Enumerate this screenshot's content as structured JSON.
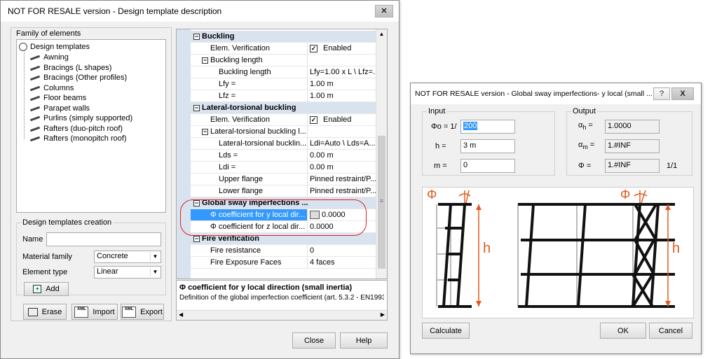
{
  "dialog_main": {
    "title": "NOT FOR RESALE version - Design template description",
    "family_label": "Family of elements",
    "tree": {
      "root": "Design templates",
      "items": [
        "Awning",
        "Bracings (L shapes)",
        "Bracings (Other profiles)",
        "Columns",
        "Floor beams",
        "Parapet walls",
        "Purlins (simply supported)",
        "Rafters (duo-pitch roof)",
        "Rafters (monopitch roof)"
      ]
    },
    "creation": {
      "label": "Design templates creation",
      "name_label": "Name",
      "name_value": "",
      "material_label": "Material family",
      "material_value": "Concrete",
      "element_type_label": "Element type",
      "element_type_value": "Linear",
      "add_label": "Add"
    },
    "buttons": {
      "erase": "Erase",
      "import": "Import",
      "export": "Export",
      "close": "Close",
      "help": "Help"
    },
    "properties": [
      {
        "name": "Buckling",
        "value": "",
        "kind": "cat",
        "level": 0
      },
      {
        "name": "Elem. Verification",
        "value": "Enabled",
        "kind": "check",
        "level": 1
      },
      {
        "name": "Buckling length",
        "value": "",
        "kind": "sub",
        "level": 1
      },
      {
        "name": "Buckling length",
        "value": "Lfy=1.00 x L \\ Lfz=...",
        "kind": "prop",
        "level": 2
      },
      {
        "name": "Lfy =",
        "value": "1.00 m",
        "kind": "prop",
        "level": 2
      },
      {
        "name": "Lfz =",
        "value": "1.00 m",
        "kind": "prop",
        "level": 2
      },
      {
        "name": "Lateral-torsional buckling",
        "value": "",
        "kind": "cat",
        "level": 0
      },
      {
        "name": "Elem. Verification",
        "value": "Enabled",
        "kind": "check",
        "level": 1
      },
      {
        "name": "Lateral-torsional buckling l...",
        "value": "",
        "kind": "sub",
        "level": 1
      },
      {
        "name": "Lateral-torsional bucklin...",
        "value": "Ldi=Auto \\ Lds=A...",
        "kind": "prop",
        "level": 2
      },
      {
        "name": "Lds =",
        "value": "0.00 m",
        "kind": "prop",
        "level": 2
      },
      {
        "name": "Ldi =",
        "value": "0.00 m",
        "kind": "prop",
        "level": 2
      },
      {
        "name": "Upper flange",
        "value": "Pinned restraint/P...",
        "kind": "prop",
        "level": 2
      },
      {
        "name": "Lower flange",
        "value": "Pinned restraint/P...",
        "kind": "prop",
        "level": 2
      },
      {
        "name": "Global sway imperfections ...",
        "value": "",
        "kind": "cat",
        "level": 0
      },
      {
        "name": "Φ coefficient for y local dir...",
        "value": "0.0000",
        "kind": "sel",
        "level": 1
      },
      {
        "name": "Φ coefficient for z local dir...",
        "value": "0.0000",
        "kind": "prop",
        "level": 1
      },
      {
        "name": "Fire verification",
        "value": "",
        "kind": "cat",
        "level": 0
      },
      {
        "name": "Fire resistance",
        "value": "0",
        "kind": "prop",
        "level": 1
      },
      {
        "name": "Fire Exposure Faces",
        "value": "4 faces",
        "kind": "prop",
        "level": 1
      }
    ],
    "description": {
      "title": "Φ coefficient for y local direction (small inertia)",
      "text": "Definition of the global imperfection coefficient (art. 5.3.2 - EN1993"
    }
  },
  "dialog_sway": {
    "title": "NOT FOR RESALE version - Global sway imperfections- y local (small ...",
    "help_glyph": "?",
    "close_glyph": "X",
    "input": {
      "label": "Input",
      "phi0_label": "Φo = 1/",
      "phi0_value": "200",
      "h_label": "h =",
      "h_value": "3 m",
      "m_label": "m =",
      "m_value": "0"
    },
    "output": {
      "label": "Output",
      "alpha_h_label": "α",
      "alpha_h_sub": "h",
      "alpha_h_value": "1.0000",
      "alpha_m_label": "α",
      "alpha_m_sub": "m",
      "alpha_m_value": "1.#INF",
      "phi_label": "Φ",
      "phi_value": "1.#INF",
      "phi_suffix": "1/1"
    },
    "diagram": {
      "phi": "Φ",
      "h": "h"
    },
    "buttons": {
      "calculate": "Calculate",
      "ok": "OK",
      "cancel": "Cancel"
    }
  },
  "colors": {
    "selection": "#3399ff",
    "category": "#d9e3f0",
    "annotation": "#e05a1e",
    "highlight_ring": "#e02020"
  }
}
